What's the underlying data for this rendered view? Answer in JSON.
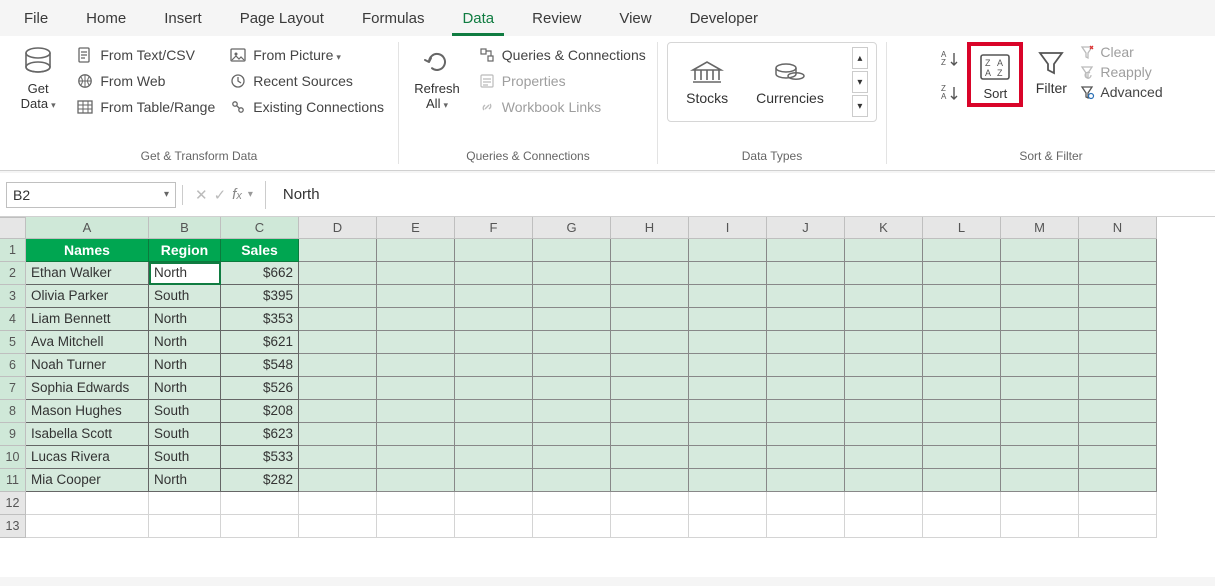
{
  "tabs": {
    "file": "File",
    "home": "Home",
    "insert": "Insert",
    "page": "Page Layout",
    "formulas": "Formulas",
    "data": "Data",
    "review": "Review",
    "view": "View",
    "dev": "Developer"
  },
  "ribbon": {
    "getdata": "Get\nData",
    "from_text": "From Text/CSV",
    "from_web": "From Web",
    "from_table": "From Table/Range",
    "from_pic": "From Picture",
    "recent": "Recent Sources",
    "existing": "Existing Connections",
    "group1": "Get & Transform Data",
    "refresh": "Refresh\nAll",
    "queries": "Queries & Connections",
    "properties": "Properties",
    "wblinks": "Workbook Links",
    "group2": "Queries & Connections",
    "stocks": "Stocks",
    "currencies": "Currencies",
    "group3": "Data Types",
    "sort": "Sort",
    "filter": "Filter",
    "clear": "Clear",
    "reapply": "Reapply",
    "advanced": "Advanced",
    "group4": "Sort & Filter"
  },
  "namebox": "B2",
  "formula_value": "North",
  "colw": {
    "A": 123,
    "B": 72,
    "C": 78,
    "rest": 78
  },
  "headers": {
    "A": "Names",
    "B": "Region",
    "C": "Sales"
  },
  "columns": [
    "A",
    "B",
    "C",
    "D",
    "E",
    "F",
    "G",
    "H",
    "I",
    "J",
    "K",
    "L",
    "M",
    "N"
  ],
  "data_rows": [
    {
      "r": 2,
      "name": "Ethan Walker",
      "region": "North",
      "sales": "$662"
    },
    {
      "r": 3,
      "name": "Olivia Parker",
      "region": "South",
      "sales": "$395"
    },
    {
      "r": 4,
      "name": "Liam Bennett",
      "region": "North",
      "sales": "$353"
    },
    {
      "r": 5,
      "name": "Ava Mitchell",
      "region": "North",
      "sales": "$621"
    },
    {
      "r": 6,
      "name": "Noah Turner",
      "region": "North",
      "sales": "$548"
    },
    {
      "r": 7,
      "name": "Sophia Edwards",
      "region": "North",
      "sales": "$526"
    },
    {
      "r": 8,
      "name": "Mason Hughes",
      "region": "South",
      "sales": "$208"
    },
    {
      "r": 9,
      "name": "Isabella Scott",
      "region": "South",
      "sales": "$623"
    },
    {
      "r": 10,
      "name": "Lucas Rivera",
      "region": "South",
      "sales": "$533"
    },
    {
      "r": 11,
      "name": "Mia Cooper",
      "region": "North",
      "sales": "$282"
    }
  ],
  "empty_rows": [
    12,
    13
  ]
}
